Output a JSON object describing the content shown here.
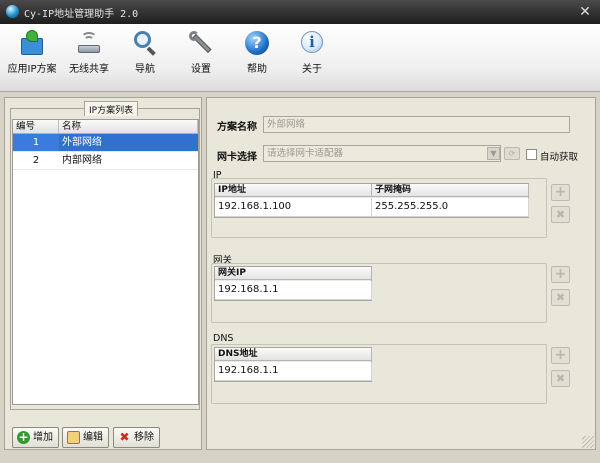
{
  "window": {
    "title": "Cy-IP地址管理助手 2.0",
    "close": "✕"
  },
  "toolbar": {
    "items": [
      {
        "label": "应用IP方案",
        "icon": "apply-scheme-icon"
      },
      {
        "label": "无线共享",
        "icon": "wifi-share-icon"
      },
      {
        "label": "导航",
        "icon": "magnifier-icon"
      },
      {
        "label": "设置",
        "icon": "wrench-icon"
      },
      {
        "label": "帮助",
        "icon": "help-icon"
      },
      {
        "label": "关于",
        "icon": "info-icon"
      }
    ]
  },
  "scheme_list": {
    "group_title": "IP方案列表",
    "columns": [
      "编号",
      "名称"
    ],
    "rows": [
      {
        "id": "1",
        "name": "外部网络",
        "selected": true
      },
      {
        "id": "2",
        "name": "内部网络",
        "selected": false
      }
    ],
    "buttons": {
      "add": "增加",
      "edit": "编辑",
      "remove": "移除"
    }
  },
  "details": {
    "scheme_name_label": "方案名称",
    "scheme_name_value": "外部网络",
    "nic_label": "网卡选择",
    "nic_placeholder": "请选择网卡适配器",
    "auto_get_label": "自动获取",
    "ip_section": {
      "title": "IP",
      "columns": [
        "IP地址",
        "子网掩码"
      ],
      "row": [
        "192.168.1.100",
        "255.255.255.0"
      ]
    },
    "gateway_section": {
      "title": "网关",
      "columns": [
        "网关IP"
      ],
      "row": [
        "192.168.1.1"
      ]
    },
    "dns_section": {
      "title": "DNS",
      "columns": [
        "DNS地址"
      ],
      "row": [
        "192.168.1.1"
      ]
    },
    "add_symbol": "+",
    "remove_symbol": "✖"
  },
  "colors": {
    "selection": "#3071d0",
    "panel": "#e9e6da",
    "titlebar": "#2a2a2a"
  }
}
